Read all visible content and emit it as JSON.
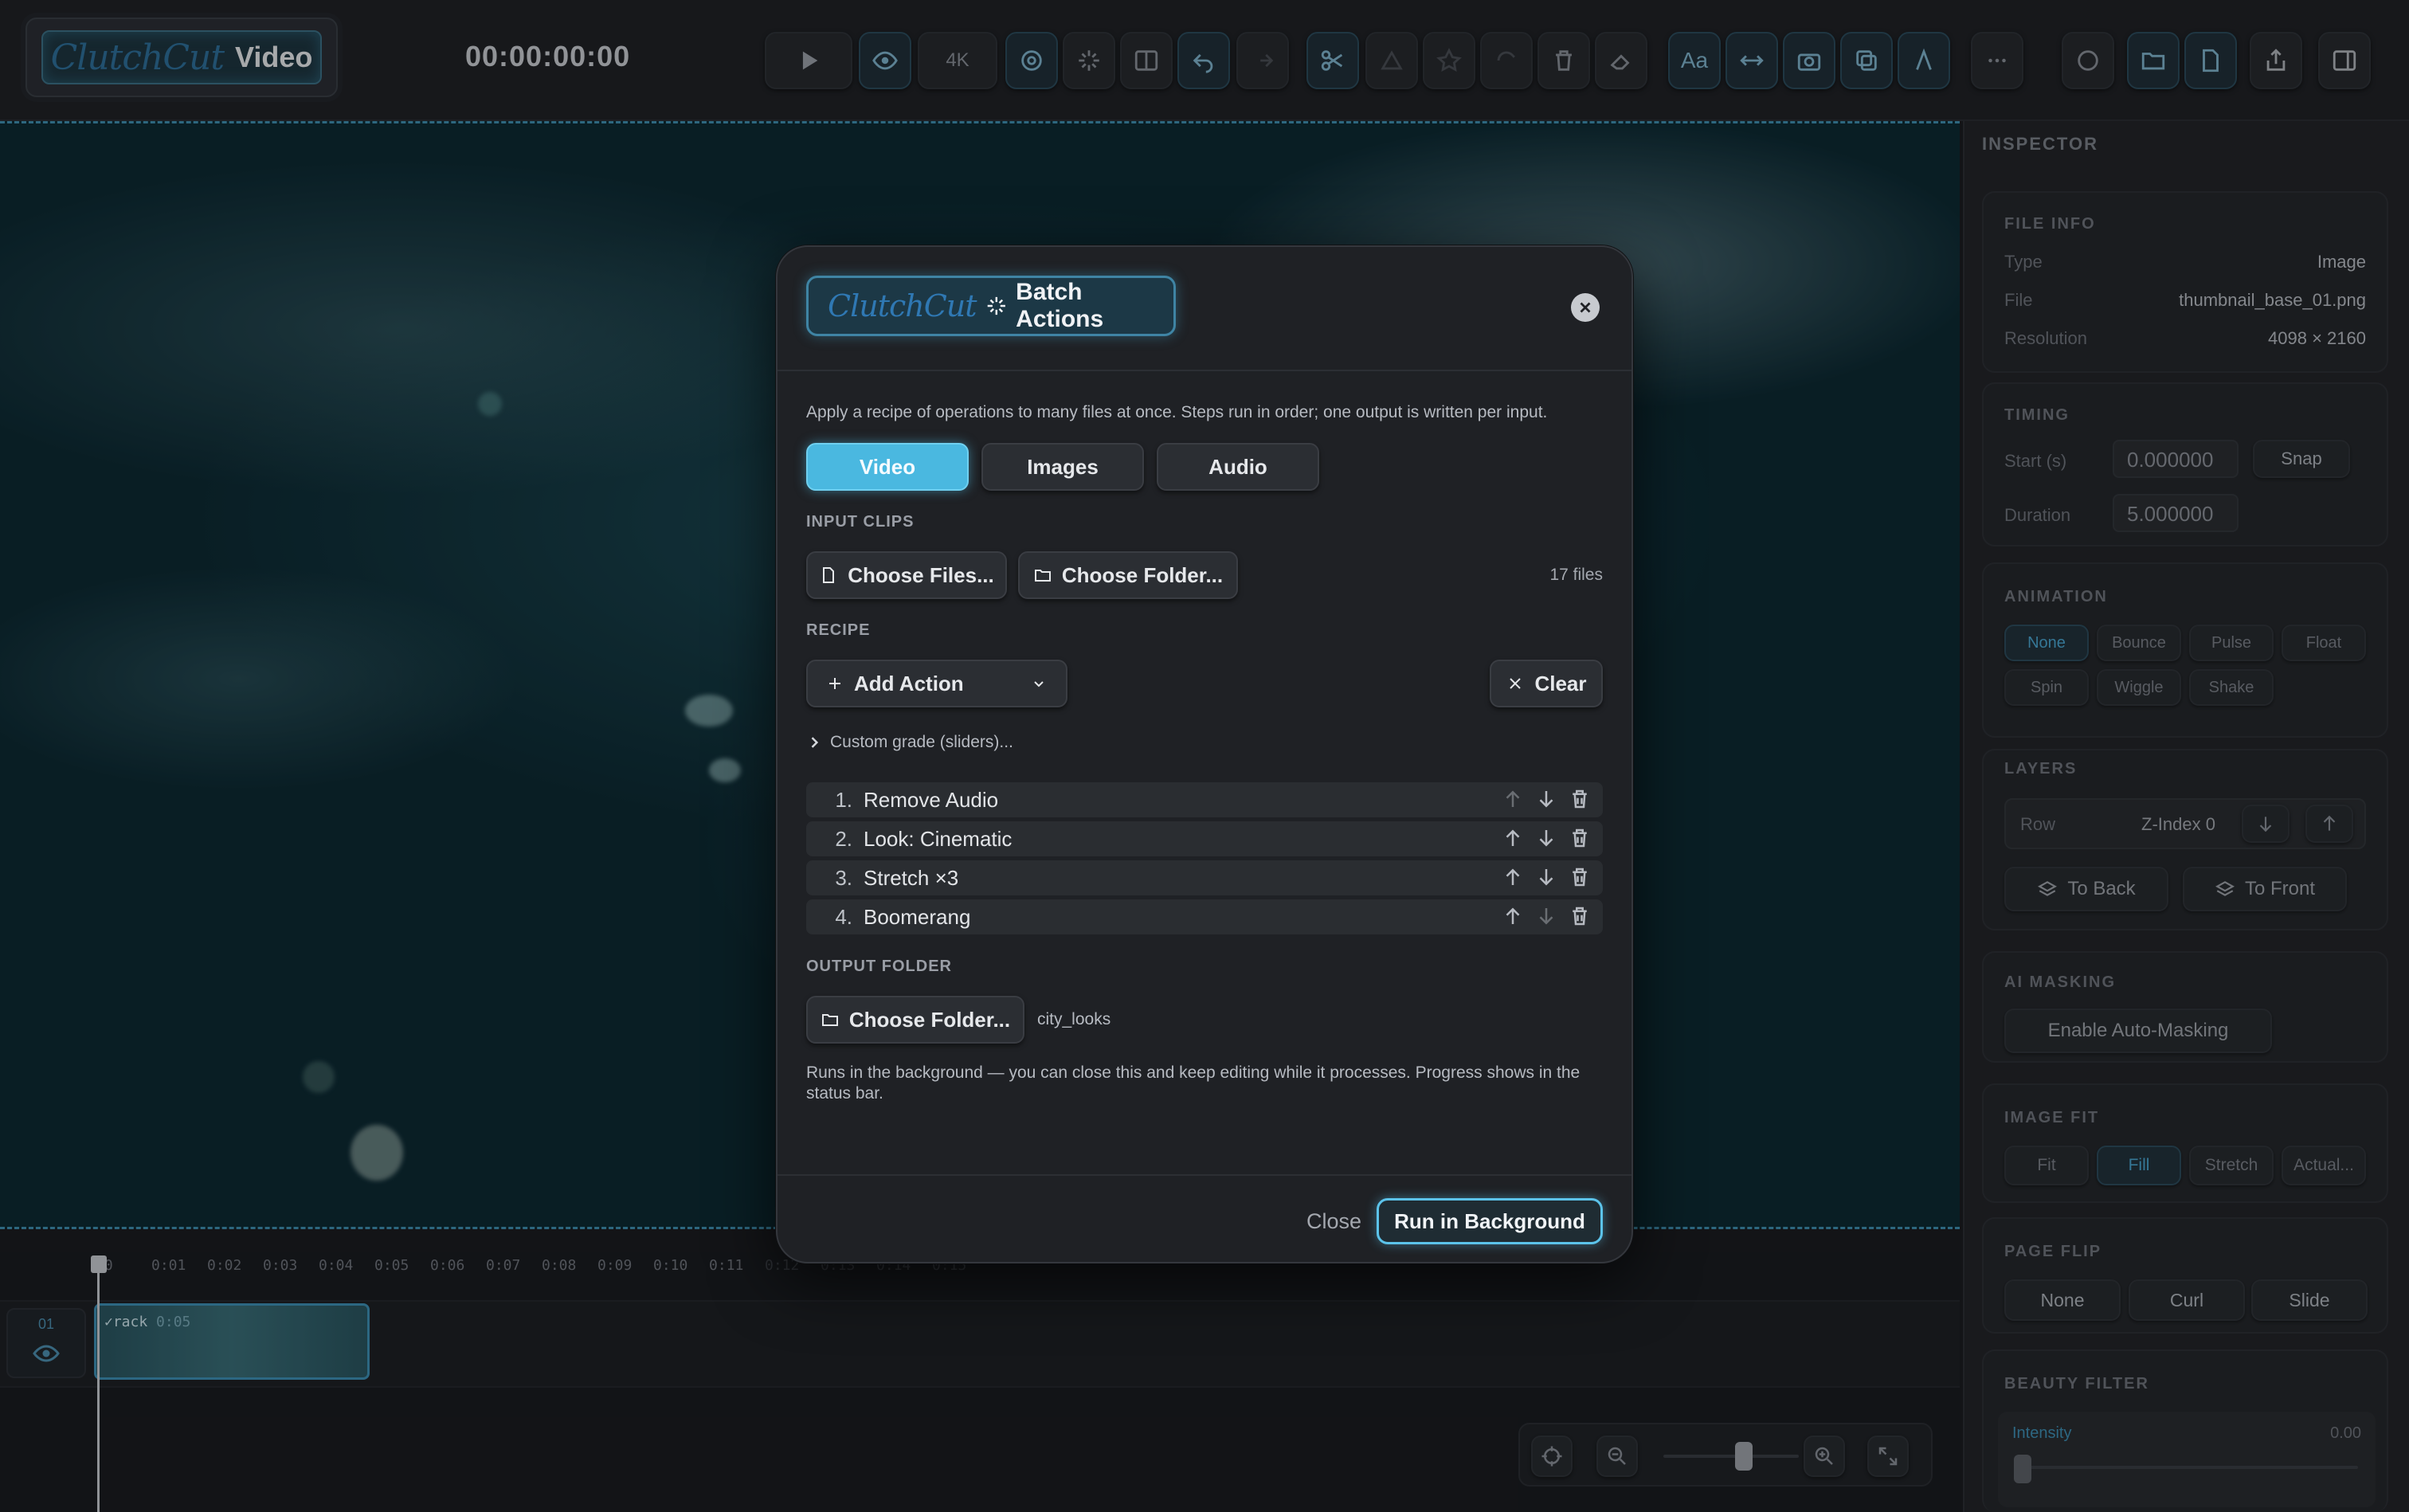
{
  "app": {
    "logo_script": "ClutchCut",
    "logo_word": "Video",
    "timecode": "00:00:00:00"
  },
  "toolbar": {
    "items": [
      {
        "name": "play-button",
        "icon": "play-icon"
      },
      {
        "name": "preview-button",
        "icon": "eye-icon"
      },
      {
        "name": "resolution-button",
        "label": "4K"
      },
      {
        "name": "target-button",
        "icon": "target-icon"
      },
      {
        "name": "effects-button",
        "icon": "sparkle-icon"
      },
      {
        "name": "split-view-button",
        "icon": "split-icon"
      },
      {
        "name": "undo-button",
        "icon": "undo-icon"
      },
      {
        "name": "redo-button",
        "icon": "redo-icon"
      },
      {
        "name": "cut-button",
        "icon": "scissors-icon"
      },
      {
        "name": "trash-button",
        "icon": "trash-icon"
      },
      {
        "name": "text-button",
        "label": "Aa"
      }
    ]
  },
  "timeline": {
    "ticks": [
      "00",
      "0:01",
      "0:02",
      "0:03",
      "0:04",
      "0:05",
      "0:06",
      "0:07",
      "0:08",
      "0:09",
      "0:10",
      "0:11",
      "0:12",
      "0:13",
      "0:14",
      "0:15"
    ],
    "track_label": "01",
    "clip_label": "rack",
    "clip_duration": "0:05"
  },
  "inspector": {
    "title": "INSPECTOR",
    "file_info": {
      "heading": "FILE INFO",
      "type_k": "Type",
      "type_v": "Image",
      "file_k": "File",
      "file_v": "thumbnail_base_01.png",
      "res_k": "Resolution",
      "res_v": "4098 × 2160"
    },
    "timing": {
      "heading": "TIMING",
      "start_k": "Start (s)",
      "start_v": "0.000000",
      "snap": "Snap",
      "dur_k": "Duration",
      "dur_v": "5.000000"
    },
    "animation": {
      "heading": "ANIMATION",
      "options": [
        "None",
        "Bounce",
        "Pulse",
        "Float",
        "Spin",
        "Wiggle",
        "Shake"
      ],
      "selected": "None"
    },
    "layers": {
      "heading": "LAYERS",
      "row": "Row",
      "zindex": "Z-Index 0",
      "to_back": "To Back",
      "to_front": "To Front"
    },
    "ai_masking": {
      "heading": "AI MASKING",
      "button": "Enable Auto-Masking"
    },
    "image_fit": {
      "heading": "IMAGE FIT",
      "options": [
        "Fit",
        "Fill",
        "Stretch",
        "Actual..."
      ],
      "selected": "Fill"
    },
    "page_flip": {
      "heading": "PAGE FLIP",
      "options": [
        "None",
        "Curl",
        "Slide"
      ]
    },
    "beauty_filter": {
      "heading": "BEAUTY FILTER",
      "intensity_label": "Intensity",
      "intensity_value": "0.00"
    }
  },
  "modal": {
    "logo_script": "ClutchCut",
    "title": "Batch Actions",
    "description": "Apply a recipe of operations to many files at once. Steps run in order; one output is written per input.",
    "tabs": [
      "Video",
      "Images",
      "Audio"
    ],
    "selected_tab": "Video",
    "input_clips": {
      "heading": "INPUT CLIPS",
      "choose_files": "Choose Files...",
      "choose_folder": "Choose Folder...",
      "count": "17 files"
    },
    "recipe": {
      "heading": "RECIPE",
      "add_action": "Add Action",
      "clear": "Clear",
      "custom_grade": "Custom grade (sliders)...",
      "steps": [
        {
          "num": "1.",
          "label": "Remove Audio"
        },
        {
          "num": "2.",
          "label": "Look: Cinematic"
        },
        {
          "num": "3.",
          "label": "Stretch ×3"
        },
        {
          "num": "4.",
          "label": "Boomerang"
        }
      ]
    },
    "output": {
      "heading": "OUTPUT FOLDER",
      "choose_folder": "Choose Folder...",
      "folder_name": "city_looks"
    },
    "note": "Runs in the background — you can close this and keep editing while it processes. Progress shows in the status bar.",
    "close": "Close",
    "run": "Run in Background"
  },
  "colors": {
    "accent": "#4ab8e0",
    "panel": "#232529",
    "modal": "#1f2125"
  }
}
